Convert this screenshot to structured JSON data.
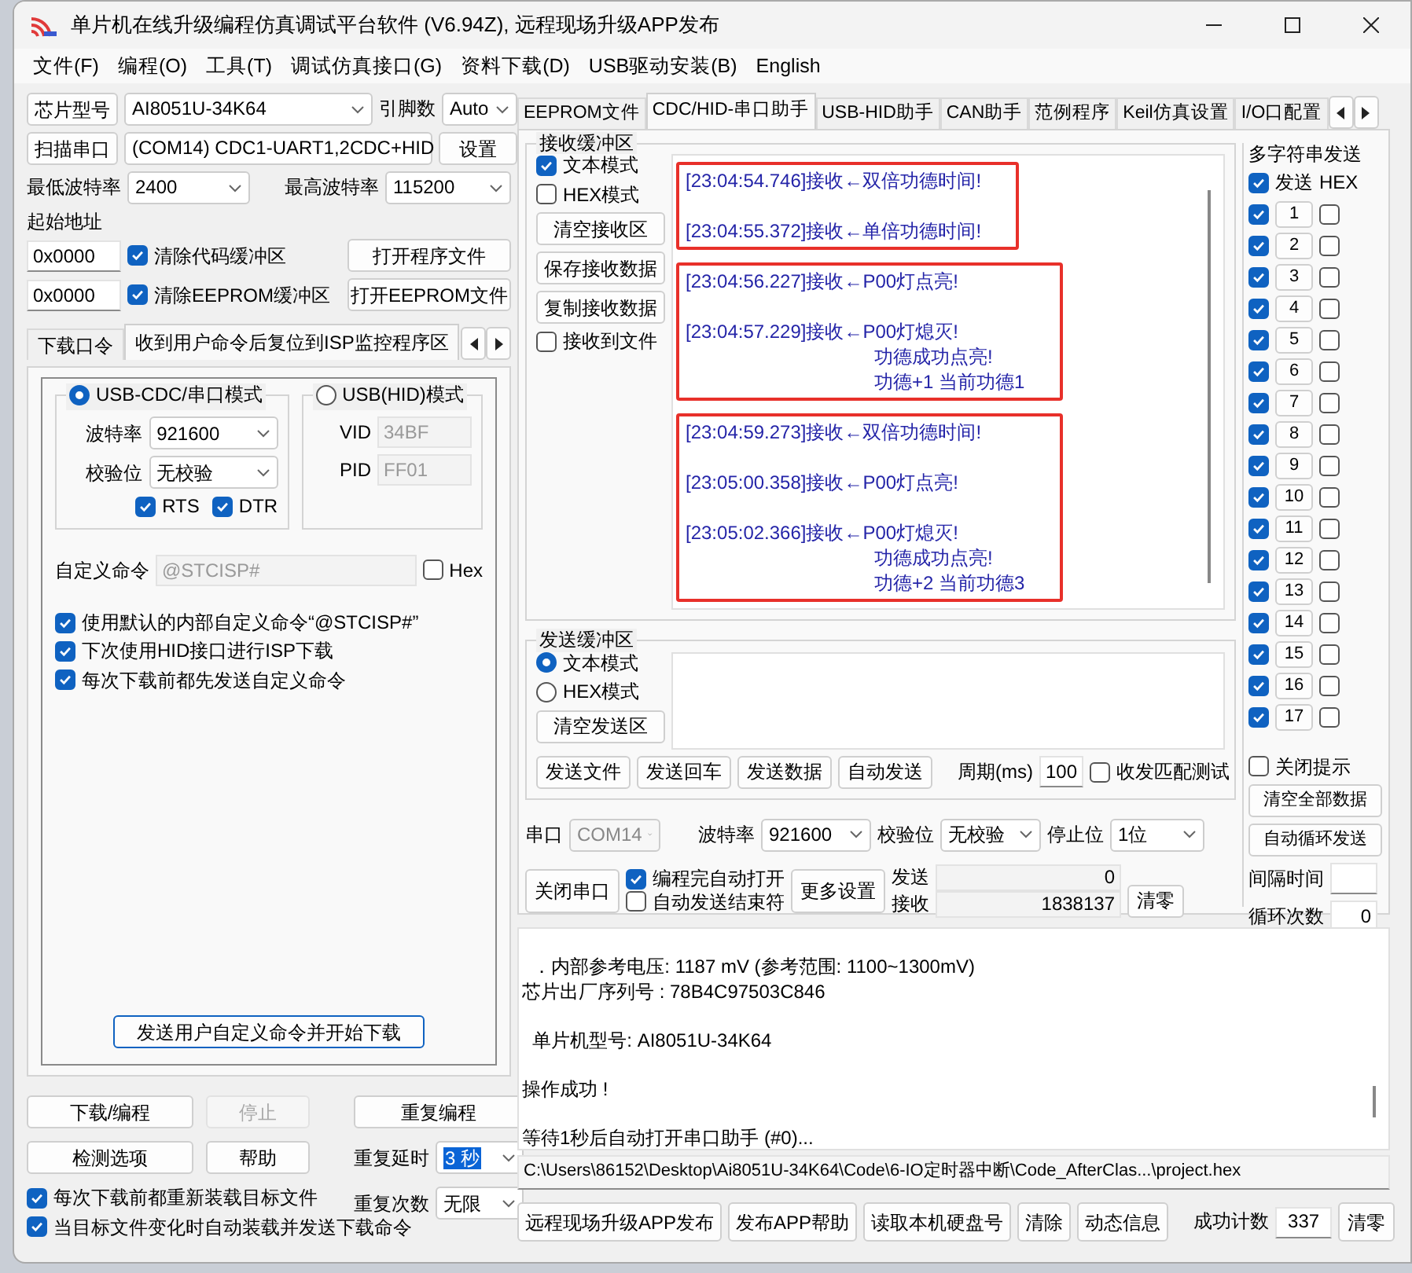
{
  "window": {
    "title": "单片机在线升级编程仿真调试平台软件 (V6.94Z), 远程现场升级APP发布"
  },
  "menu": [
    "文件(F)",
    "编程(O)",
    "工具(T)",
    "调试仿真接口(G)",
    "资料下载(D)",
    "USB驱动安装(B)",
    "English"
  ],
  "chip": {
    "button": "芯片型号",
    "model": "AI8051U-34K64",
    "pins_label": "引脚数",
    "pins": "Auto"
  },
  "port": {
    "button": "扫描串口",
    "value": "(COM14) CDC1-UART1,2CDC+HID",
    "settings": "设置"
  },
  "baud": {
    "min_label": "最低波特率",
    "min": "2400",
    "max_label": "最高波特率",
    "max": "115200"
  },
  "start_address": {
    "label": "起始地址",
    "rows": [
      {
        "address": "0x0000",
        "label": "清除代码缓冲区",
        "checked": true,
        "button": "打开程序文件"
      },
      {
        "address": "0x0000",
        "label": "清除EEPROM缓冲区",
        "checked": true,
        "button": "打开EEPROM文件"
      }
    ]
  },
  "download_tabs": [
    {
      "label": "下载口令",
      "selected": false
    },
    {
      "label": "收到用户命令后复位到ISP监控程序区",
      "selected": true
    }
  ],
  "modes": [
    {
      "label": "USB-CDC/串口模式",
      "selected": true,
      "fields": [
        {
          "label": "波特率",
          "value": "921600",
          "kind": "select"
        },
        {
          "label": "校验位",
          "value": "无校验",
          "kind": "select"
        }
      ],
      "checks": [
        {
          "label": "RTS",
          "checked": true
        },
        {
          "label": "DTR",
          "checked": true
        }
      ]
    },
    {
      "label": "USB(HID)模式",
      "selected": false,
      "fields": [
        {
          "label": "VID",
          "value": "34BF",
          "kind": "input"
        },
        {
          "label": "PID",
          "value": "FF01",
          "kind": "input"
        }
      ]
    }
  ],
  "custom_command": {
    "label": "自定义命令",
    "value": "@STCISP#",
    "hex_label": "Hex",
    "hex_checked": false
  },
  "command_options": [
    {
      "label": "使用默认的内部自定义命令“@STCISP#”",
      "checked": true
    },
    {
      "label": "下次使用HID接口进行ISP下载",
      "checked": true
    },
    {
      "label": "每次下载前都先发送自定义命令",
      "checked": true
    }
  ],
  "send_command_button": "发送用户自定义命令并开始下载",
  "program_buttons": [
    {
      "label": "下载/编程",
      "disabled": false
    },
    {
      "label": "停止",
      "disabled": true
    },
    {
      "label": "检测选项",
      "disabled": false
    },
    {
      "label": "帮助",
      "disabled": false
    }
  ],
  "repeat_button": "重复编程",
  "repeat_settings": [
    {
      "label": "重复延时",
      "value": "3 秒",
      "selected": true
    },
    {
      "label": "重复次数",
      "value": "无限",
      "selected": false
    }
  ],
  "reload_options": [
    {
      "label": "每次下载前都重新装载目标文件",
      "checked": true
    },
    {
      "label": "当目标文件变化时自动装载并发送下载命令",
      "checked": true
    }
  ],
  "tool_tabs": [
    {
      "label": "EEPROM文件",
      "selected": false
    },
    {
      "label": "CDC/HID-串口助手",
      "selected": true
    },
    {
      "label": "USB-HID助手",
      "selected": false
    },
    {
      "label": "CAN助手",
      "selected": false
    },
    {
      "label": "范例程序",
      "selected": false
    },
    {
      "label": "Keil仿真设置",
      "selected": false
    },
    {
      "label": "I/O口配置",
      "selected": false
    }
  ],
  "receive": {
    "title": "接收缓冲区",
    "modes": [
      {
        "label": "文本模式",
        "checked": true
      },
      {
        "label": "HEX模式",
        "checked": false
      }
    ],
    "buttons": [
      "清空接收区",
      "保存接收数据",
      "复制接收数据"
    ],
    "to_file": {
      "label": "接收到文件",
      "checked": false
    },
    "groups": [
      {
        "framed": true,
        "messages": [
          {
            "text": "[23:04:54.746]接收←双倍功德时间!"
          },
          {
            "text": "[23:04:55.372]接收←单倍功德时间!"
          }
        ]
      },
      {
        "framed": true,
        "messages": [
          {
            "text": "[23:04:56.227]接收←P00灯点亮!"
          },
          {
            "text": "[23:04:57.229]接收←P00灯熄灭!",
            "continuation": [
              "功德成功点亮!",
              "功德+1 当前功德1"
            ]
          }
        ]
      },
      {
        "framed": true,
        "messages": [
          {
            "text": "[23:04:59.273]接收←双倍功德时间!"
          },
          {
            "text": "[23:05:00.358]接收←P00灯点亮!"
          },
          {
            "text": "[23:05:02.366]接收←P00灯熄灭!",
            "continuation": [
              "功德成功点亮!",
              "功德+2 当前功德3"
            ]
          }
        ]
      }
    ]
  },
  "send": {
    "title": "发送缓冲区",
    "modes": [
      {
        "label": "文本模式",
        "selected": true
      },
      {
        "label": "HEX模式",
        "selected": false
      }
    ],
    "clear_button": "清空发送区",
    "actions": [
      "发送文件",
      "发送回车",
      "发送数据",
      "自动发送"
    ],
    "period_label": "周期(ms)",
    "period": "100",
    "match_test": {
      "label": "收发匹配测试",
      "checked": false
    }
  },
  "serial": {
    "port_label": "串口",
    "port": "COM14",
    "baud_label": "波特率",
    "baud": "921600",
    "parity_label": "校验位",
    "parity": "无校验",
    "stop_label": "停止位",
    "stop": "1位",
    "close_button": "关闭串口",
    "options": [
      {
        "label": "编程完自动打开",
        "checked": true
      },
      {
        "label": "自动发送结束符",
        "checked": false
      }
    ],
    "more_button": "更多设置",
    "counters": [
      {
        "label": "发送",
        "value": "0"
      },
      {
        "label": "接收",
        "value": "1838137"
      }
    ],
    "reset_button": "清零"
  },
  "multi_send": {
    "title": "多字符串发送",
    "send_label": "发送",
    "send_checked": true,
    "hex_label": "HEX",
    "rows": [
      {
        "label": "1",
        "checked": true,
        "hex": false
      },
      {
        "label": "2",
        "checked": true,
        "hex": false
      },
      {
        "label": "3",
        "checked": true,
        "hex": false
      },
      {
        "label": "4",
        "checked": true,
        "hex": false
      },
      {
        "label": "5",
        "checked": true,
        "hex": false
      },
      {
        "label": "6",
        "checked": true,
        "hex": false
      },
      {
        "label": "7",
        "checked": true,
        "hex": false
      },
      {
        "label": "8",
        "checked": true,
        "hex": false
      },
      {
        "label": "9",
        "checked": true,
        "hex": false
      },
      {
        "label": "10",
        "checked": true,
        "hex": false
      },
      {
        "label": "11",
        "checked": true,
        "hex": false
      },
      {
        "label": "12",
        "checked": true,
        "hex": false
      },
      {
        "label": "13",
        "checked": true,
        "hex": false
      },
      {
        "label": "14",
        "checked": true,
        "hex": false
      },
      {
        "label": "15",
        "checked": true,
        "hex": false
      },
      {
        "label": "16",
        "checked": true,
        "hex": false
      },
      {
        "label": "17",
        "checked": true,
        "hex": false
      }
    ],
    "close_hint": {
      "label": "关闭提示",
      "checked": false
    },
    "buttons": [
      "清空全部数据",
      "自动循环发送"
    ],
    "interval_label": "间隔时间",
    "count_label": "循环次数",
    "count": "0"
  },
  "log": [
    {
      "lines": [
        "  ．内部参考电压: 1187 mV (参考范围: 1100~1300mV)",
        "芯片出厂序列号 : 78B4C97503C846"
      ]
    },
    {
      "lines": [
        "  单片机型号: AI8051U-34K64"
      ]
    },
    {
      "lines": [
        "操作成功 !"
      ]
    },
    {
      "lines": [
        "等待1秒后自动打开串口助手 (#0)..."
      ]
    }
  ],
  "path": "C:\\Users\\86152\\Desktop\\Ai8051U-34K64\\Code\\6-IO定时器中断\\Code_AfterClas...\\project.hex",
  "footer": {
    "buttons": [
      "远程现场升级APP发布",
      "发布APP帮助",
      "读取本机硬盘号",
      "清除",
      "动态信息"
    ],
    "count_label": "成功计数",
    "count": "337",
    "reset_button": "清零"
  }
}
